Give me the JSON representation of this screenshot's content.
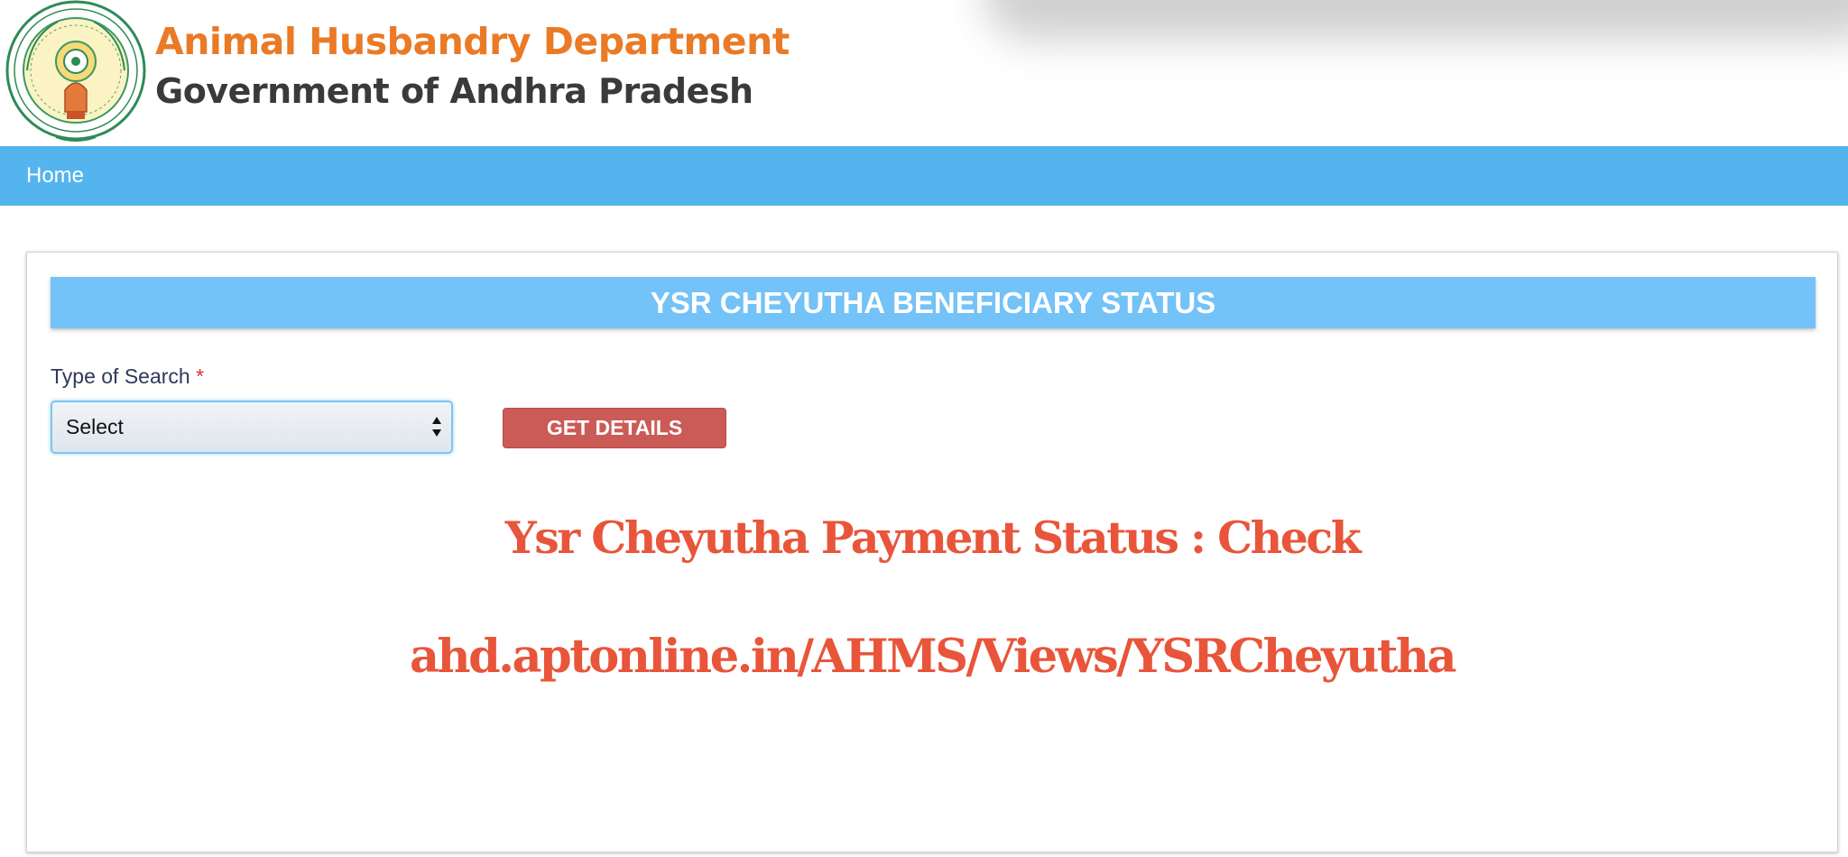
{
  "header": {
    "department_title": "Animal Husbandry Department",
    "government_title": "Government of Andhra Pradesh",
    "logo_icon": "andhra-pradesh-emblem-seal",
    "colors": {
      "department_title": "#ea7a26",
      "government_title": "#3a3a3a"
    }
  },
  "navbar": {
    "home_label": "Home",
    "background": "#54b4ee"
  },
  "panel": {
    "heading": "YSR CHEYUTHA BENEFICIARY STATUS",
    "type_of_search": {
      "label": "Type of Search",
      "required_mark": "*",
      "selected_value": "Select",
      "arrow_icon": "select-updown-arrows-icon"
    },
    "get_details_label": "GET DETAILS",
    "button_color": "#cb5b57"
  },
  "overlay": {
    "line1": "Ysr Cheyutha Payment Status : Check",
    "line2": "ahd.aptonline.in/AHMS/Views/YSRCheyutha",
    "color": "#e8553a"
  }
}
